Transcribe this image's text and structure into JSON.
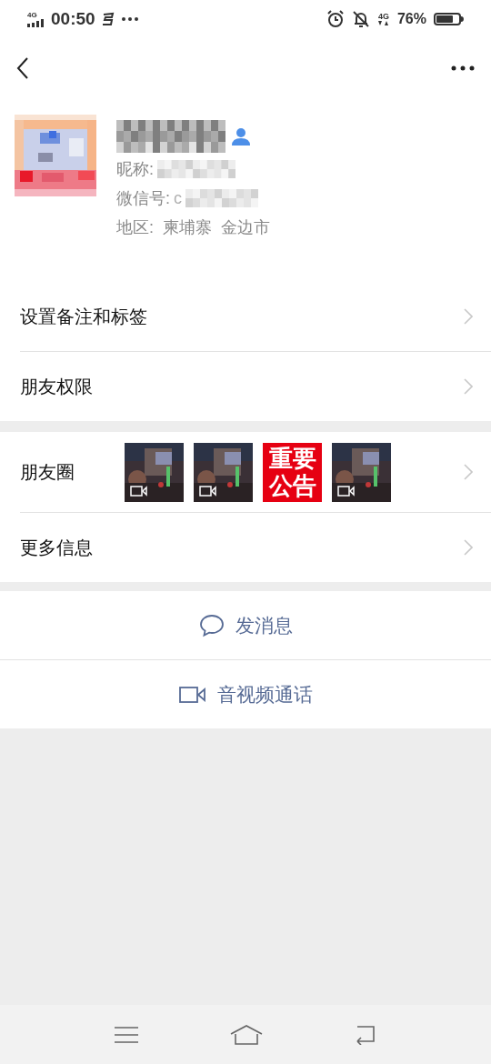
{
  "status_bar": {
    "network": "4G",
    "time": "00:50",
    "battery_text": "76%",
    "right_network": "4G"
  },
  "profile": {
    "nickname_label": "昵称:",
    "wechat_id_label": "微信号:",
    "wechat_id_start": "c",
    "region": "地区:  柬埔寨  金边市"
  },
  "menu_groups": [
    [
      {
        "kind": "text",
        "label": "设置备注和标签"
      },
      {
        "kind": "text",
        "label": "朋友权限"
      }
    ],
    [
      {
        "kind": "moments",
        "label": "朋友圈",
        "thumbnails": [
          {
            "kind": "video"
          },
          {
            "kind": "video"
          },
          {
            "kind": "notice",
            "text": "重要公告"
          },
          {
            "kind": "video"
          }
        ]
      },
      {
        "kind": "text",
        "label": "更多信息"
      }
    ]
  ],
  "actions": [
    {
      "kind": "message",
      "label": "发消息"
    },
    {
      "kind": "call",
      "label": "音视频通话"
    }
  ]
}
